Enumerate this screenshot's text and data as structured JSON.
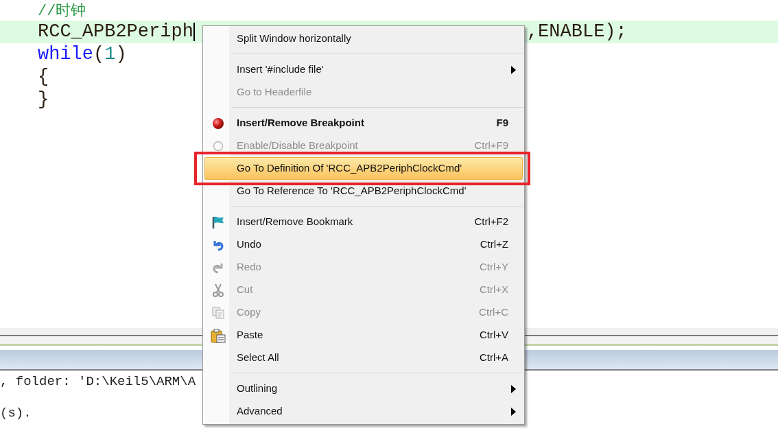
{
  "editor": {
    "lines": [
      {
        "current": false,
        "tokens": [
          {
            "kind": "comment",
            "text": "//时钟"
          }
        ]
      },
      {
        "current": true,
        "tokens": [
          {
            "kind": "plain",
            "text": "RCC_APB2Periph"
          }
        ],
        "tail": ",ENABLE);"
      },
      {
        "current": false,
        "tokens": [
          {
            "kind": "keyword",
            "text": "while"
          },
          {
            "kind": "plain",
            "text": "("
          },
          {
            "kind": "number",
            "text": "1"
          },
          {
            "kind": "plain",
            "text": ")"
          }
        ]
      },
      {
        "current": false,
        "tokens": [
          {
            "kind": "plain",
            "text": "{"
          }
        ]
      },
      {
        "current": false,
        "tokens": [
          {
            "kind": "plain",
            "text": "}"
          }
        ]
      }
    ]
  },
  "output": {
    "lines": [
      ", folder: 'D:\\Keil5\\ARM\\A",
      "(s)."
    ]
  },
  "context_menu": {
    "items": [
      {
        "kind": "item",
        "label": "Split Window horizontally",
        "selected": false,
        "disabled": false,
        "default": false,
        "submenu": false
      },
      {
        "kind": "separator"
      },
      {
        "kind": "item",
        "label": "Insert '#include file'",
        "selected": false,
        "disabled": false,
        "default": false,
        "submenu": true
      },
      {
        "kind": "item",
        "label": "Go to Headerfile",
        "selected": false,
        "disabled": true,
        "default": false,
        "submenu": false
      },
      {
        "kind": "separator"
      },
      {
        "kind": "item",
        "label": "Insert/Remove Breakpoint",
        "shortcut": "F9",
        "selected": false,
        "disabled": false,
        "default": true,
        "submenu": false
      },
      {
        "kind": "item",
        "label": "Enable/Disable Breakpoint",
        "shortcut": "Ctrl+F9",
        "selected": false,
        "disabled": true,
        "default": false,
        "submenu": false
      },
      {
        "kind": "item",
        "label": "Go To Definition Of 'RCC_APB2PeriphClockCmd'",
        "selected": true,
        "disabled": false,
        "default": false,
        "submenu": false
      },
      {
        "kind": "item",
        "label": "Go To Reference To 'RCC_APB2PeriphClockCmd'",
        "selected": false,
        "disabled": false,
        "default": false,
        "submenu": false
      },
      {
        "kind": "separator"
      },
      {
        "kind": "item",
        "label": "Insert/Remove Bookmark",
        "shortcut": "Ctrl+F2",
        "selected": false,
        "disabled": false,
        "default": false,
        "submenu": false
      },
      {
        "kind": "item",
        "label": "Undo",
        "shortcut": "Ctrl+Z",
        "selected": false,
        "disabled": false,
        "default": false,
        "submenu": false
      },
      {
        "kind": "item",
        "label": "Redo",
        "shortcut": "Ctrl+Y",
        "selected": false,
        "disabled": true,
        "default": false,
        "submenu": false
      },
      {
        "kind": "item",
        "label": "Cut",
        "shortcut": "Ctrl+X",
        "selected": false,
        "disabled": true,
        "default": false,
        "submenu": false
      },
      {
        "kind": "item",
        "label": "Copy",
        "shortcut": "Ctrl+C",
        "selected": false,
        "disabled": true,
        "default": false,
        "submenu": false
      },
      {
        "kind": "item",
        "label": "Paste",
        "shortcut": "Ctrl+V",
        "selected": false,
        "disabled": false,
        "default": false,
        "submenu": false
      },
      {
        "kind": "item",
        "label": "Select All",
        "shortcut": "Ctrl+A",
        "selected": false,
        "disabled": false,
        "default": false,
        "submenu": false
      },
      {
        "kind": "separator"
      },
      {
        "kind": "item",
        "label": "Outlining",
        "selected": false,
        "disabled": false,
        "default": false,
        "submenu": true
      },
      {
        "kind": "item",
        "label": "Advanced",
        "selected": false,
        "disabled": false,
        "default": false,
        "submenu": true
      }
    ]
  }
}
